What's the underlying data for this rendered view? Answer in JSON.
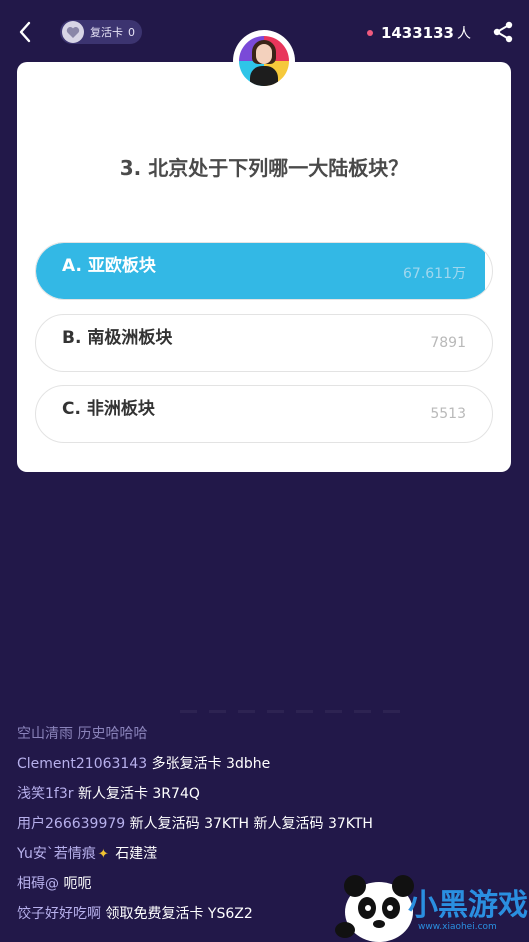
{
  "header": {
    "revive_label": "复活卡",
    "revive_count": "0",
    "online_count": "1433133",
    "online_unit": "人"
  },
  "question": {
    "text": "3. 北京处于下列哪一大陆板块？",
    "options": [
      {
        "label": "A. 亚欧板块",
        "count": "67.611万",
        "selected": true,
        "share": 0.985
      },
      {
        "label": "B. 南极洲板块",
        "count": "7891",
        "selected": false,
        "share": 0.011
      },
      {
        "label": "C. 非洲板块",
        "count": "5513",
        "selected": false,
        "share": 0.008
      }
    ]
  },
  "chat": [
    {
      "user": "空山清雨",
      "msg": "历史哈哈哈",
      "dim": true
    },
    {
      "user": "Clement21063143",
      "msg": "多张复活卡  3dbhe",
      "dim": false
    },
    {
      "user": "浅笑1f3r",
      "msg": "新人复活卡 3R74Q",
      "dim": false
    },
    {
      "user": "用户266639979",
      "msg": "新人复活码 37KTH  新人复活码 37KTH",
      "dim": false
    },
    {
      "user": "Yu安`若情痕",
      "msg": "石建滢",
      "dim": false,
      "sparkle": true
    },
    {
      "user": "相碍@",
      "msg": "呃呃",
      "dim": false
    },
    {
      "user": "饺子好好吃啊",
      "msg": "领取免费复活卡 YS6Z2",
      "dim": false
    }
  ],
  "watermark": {
    "text": "小黑游戏",
    "sub": "www.xiaohei.com"
  },
  "colors": {
    "background": "#221849",
    "accent": "#33b8e5",
    "dot": "#f05a7e"
  }
}
